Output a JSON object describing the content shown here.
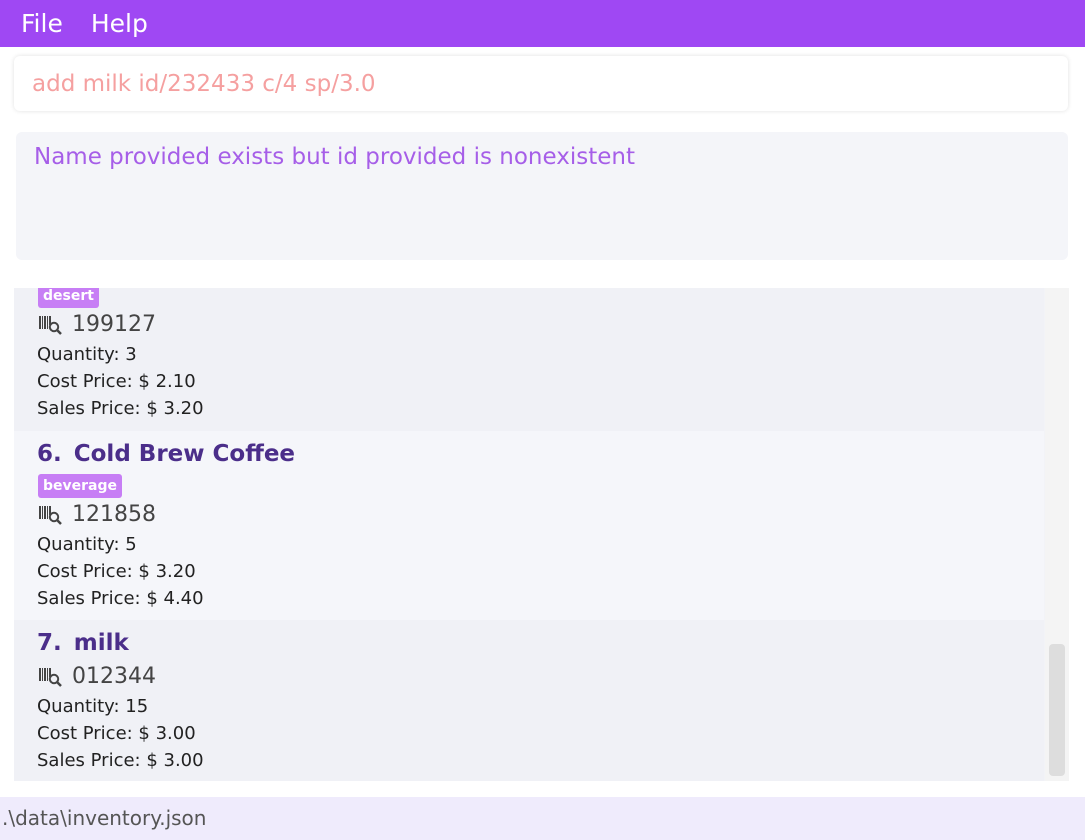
{
  "menu": {
    "file": "File",
    "help": "Help"
  },
  "command": {
    "value": "add milk id/232433 c/4 sp/3.0"
  },
  "result": {
    "message": "Name provided exists but id provided is nonexistent"
  },
  "items": [
    {
      "tag": "desert",
      "barcode": "199127",
      "quantity": "Quantity: 3",
      "cost": "Cost Price: $ 2.10",
      "sales": "Sales Price: $ 3.20"
    },
    {
      "index": "6.",
      "name": "Cold Brew Coffee",
      "tag": "beverage",
      "barcode": "121858",
      "quantity": "Quantity: 5",
      "cost": "Cost Price: $ 3.20",
      "sales": "Sales Price: $ 4.40"
    },
    {
      "index": "7.",
      "name": "milk",
      "barcode": "012344",
      "quantity": "Quantity: 15",
      "cost": "Cost Price: $ 3.00",
      "sales": "Sales Price: $ 3.00"
    }
  ],
  "status": {
    "path": ".\\data\\inventory.json"
  },
  "colors": {
    "accent": "#9f48f3",
    "tag": "#c77ef5",
    "title": "#4b2e8a",
    "message": "#a65ee8",
    "command_text": "#f5a0a0"
  },
  "icons": {
    "barcode": "barcode-search-icon"
  }
}
